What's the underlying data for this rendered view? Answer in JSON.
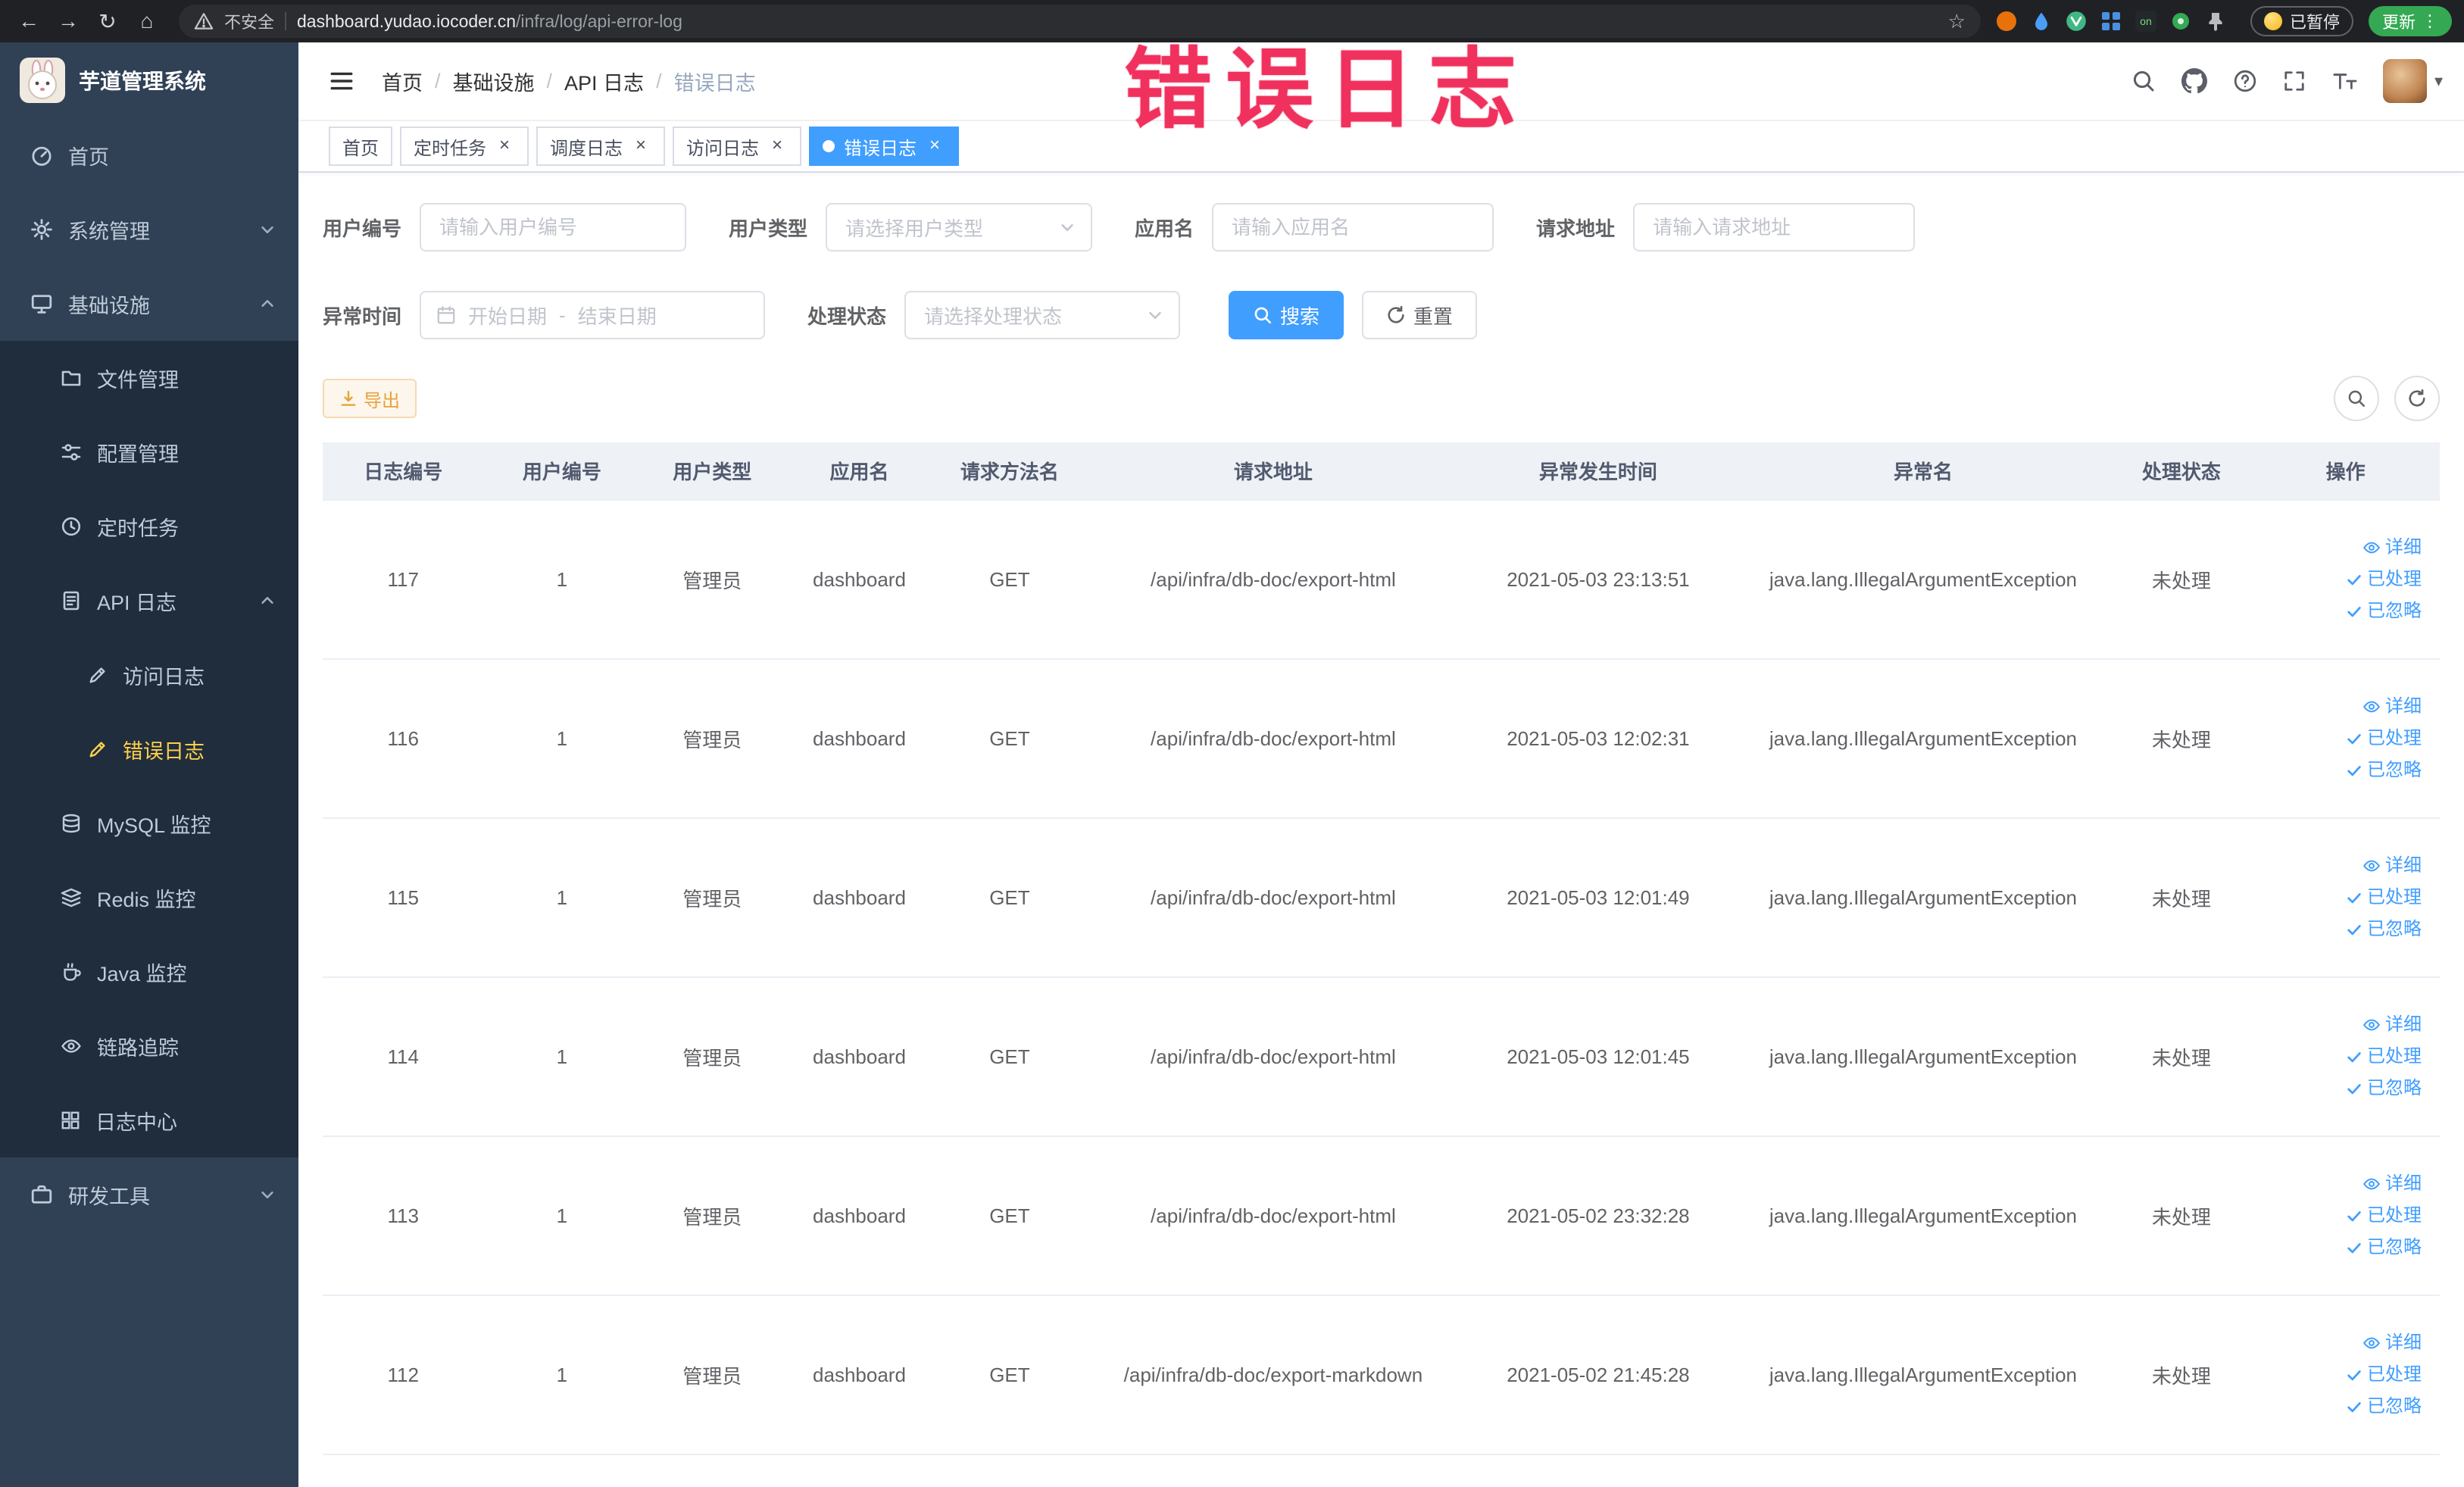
{
  "colors": {
    "accent": "#409eff",
    "warning": "#e6a23c",
    "sidebar_bg": "#304156",
    "sidebar_submenu_bg": "#1f2d3d",
    "sidebar_text": "#bfcbd9",
    "sidebar_active_text": "#ffd04b",
    "active_tab_bg": "#409eff",
    "annotation_color": "#f0315e",
    "table_header_bg": "#eef1f6"
  },
  "icons": {
    "back": "←",
    "forward": "→",
    "reload": "↻",
    "home_glyph": "⌂",
    "star": "☆",
    "kebab": "⋮",
    "caret_down": "▾",
    "tab_close": "×",
    "proxy_on": "on"
  },
  "browser": {
    "security_label": "不安全",
    "url_domain": "dashboard.yudao.iocoder.cn",
    "url_path": "/infra/log/api-error-log",
    "paused_badge_label": "已暂停",
    "update_button_label": "更新"
  },
  "annotation_text": "错误日志",
  "sidebar": {
    "app_title": "芋道管理系统",
    "items": {
      "home": "首页",
      "system_mgmt": "系统管理",
      "infrastructure": "基础设施",
      "file_mgmt": "文件管理",
      "config_mgmt": "配置管理",
      "scheduled_jobs": "定时任务",
      "api_log": "API 日志",
      "access_log": "访问日志",
      "error_log": "错误日志",
      "mysql_monitor": "MySQL 监控",
      "redis_monitor": "Redis 监控",
      "java_monitor": "Java 监控",
      "trace": "链路追踪",
      "log_center": "日志中心",
      "dev_tools": "研发工具"
    }
  },
  "breadcrumb": [
    "首页",
    "基础设施",
    "API 日志",
    "错误日志"
  ],
  "tabs": [
    {
      "label": "首页",
      "closable": false,
      "active": false
    },
    {
      "label": "定时任务",
      "closable": true,
      "active": false
    },
    {
      "label": "调度日志",
      "closable": true,
      "active": false
    },
    {
      "label": "访问日志",
      "closable": true,
      "active": false
    },
    {
      "label": "错误日志",
      "closable": true,
      "active": true
    }
  ],
  "filters": {
    "user_id": {
      "label": "用户编号",
      "placeholder": "请输入用户编号"
    },
    "user_type": {
      "label": "用户类型",
      "placeholder": "请选择用户类型"
    },
    "app_name": {
      "label": "应用名",
      "placeholder": "请输入应用名"
    },
    "request_url": {
      "label": "请求地址",
      "placeholder": "请输入请求地址"
    },
    "exception_time": {
      "label": "异常时间",
      "start_placeholder": "开始日期",
      "separator": "-",
      "end_placeholder": "结束日期"
    },
    "process_status": {
      "label": "处理状态",
      "placeholder": "请选择处理状态"
    },
    "search_button": "搜索",
    "reset_button": "重置"
  },
  "toolbar": {
    "export_label": "导出"
  },
  "table": {
    "columns": [
      "日志编号",
      "用户编号",
      "用户类型",
      "应用名",
      "请求方法名",
      "请求地址",
      "异常发生时间",
      "异常名",
      "处理状态",
      "操作"
    ],
    "row_actions": [
      {
        "label": "详细",
        "icon": "eye-icon"
      },
      {
        "label": "已处理",
        "icon": "check-icon"
      },
      {
        "label": "已忽略",
        "icon": "check-icon"
      }
    ],
    "rows": [
      {
        "log_id": "117",
        "user_id": "1",
        "user_type": "管理员",
        "app_name": "dashboard",
        "method": "GET",
        "request_url": "/api/infra/db-doc/export-html",
        "time": "2021-05-03 23:13:51",
        "exception_name": "java.lang.IllegalArgumentException",
        "status": "未处理"
      },
      {
        "log_id": "116",
        "user_id": "1",
        "user_type": "管理员",
        "app_name": "dashboard",
        "method": "GET",
        "request_url": "/api/infra/db-doc/export-html",
        "time": "2021-05-03 12:02:31",
        "exception_name": "java.lang.IllegalArgumentException",
        "status": "未处理"
      },
      {
        "log_id": "115",
        "user_id": "1",
        "user_type": "管理员",
        "app_name": "dashboard",
        "method": "GET",
        "request_url": "/api/infra/db-doc/export-html",
        "time": "2021-05-03 12:01:49",
        "exception_name": "java.lang.IllegalArgumentException",
        "status": "未处理"
      },
      {
        "log_id": "114",
        "user_id": "1",
        "user_type": "管理员",
        "app_name": "dashboard",
        "method": "GET",
        "request_url": "/api/infra/db-doc/export-html",
        "time": "2021-05-03 12:01:45",
        "exception_name": "java.lang.IllegalArgumentException",
        "status": "未处理"
      },
      {
        "log_id": "113",
        "user_id": "1",
        "user_type": "管理员",
        "app_name": "dashboard",
        "method": "GET",
        "request_url": "/api/infra/db-doc/export-html",
        "time": "2021-05-02 23:32:28",
        "exception_name": "java.lang.IllegalArgumentException",
        "status": "未处理"
      },
      {
        "log_id": "112",
        "user_id": "1",
        "user_type": "管理员",
        "app_name": "dashboard",
        "method": "GET",
        "request_url": "/api/infra/db-doc/export-markdown",
        "time": "2021-05-02 21:45:28",
        "exception_name": "java.lang.IllegalArgumentException",
        "status": "未处理"
      }
    ]
  }
}
